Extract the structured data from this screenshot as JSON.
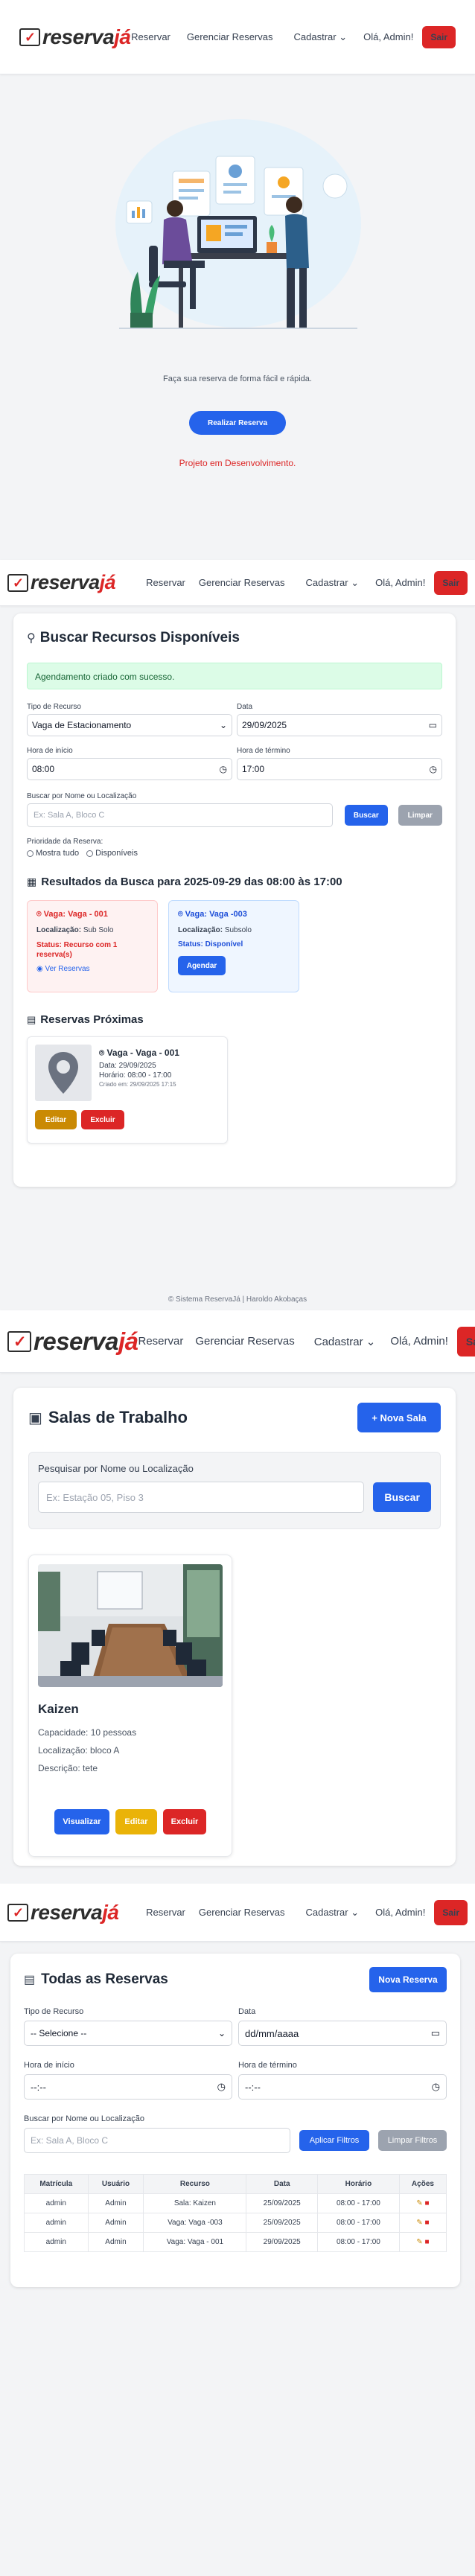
{
  "brand": {
    "part1": "reserva",
    "part2": "já"
  },
  "nav": {
    "reservar": "Reservar",
    "gerenciar": "Gerenciar Reservas",
    "cadastrar": "Cadastrar",
    "greeting": "Olá, Admin!",
    "logout": "Sair"
  },
  "home": {
    "tagline": "Faça sua reserva de forma fácil e rápida.",
    "cta": "Realizar Reserva",
    "dev_notice": "Projeto em Desenvolvimento."
  },
  "search": {
    "title": "Buscar Recursos Disponíveis",
    "success": "Agendamento criado com sucesso.",
    "tipo_label": "Tipo de Recurso",
    "tipo_value": "Vaga de Estacionamento",
    "data_label": "Data",
    "data_value": "29/09/2025",
    "inicio_label": "Hora de início",
    "inicio_value": "08:00",
    "termino_label": "Hora de término",
    "termino_value": "17:00",
    "busca_label": "Buscar por Nome ou Localização",
    "busca_placeholder": "Ex: Sala A, Bloco C",
    "buscar_btn": "Buscar",
    "limpar_btn": "Limpar",
    "prioridade_label": "Prioridade da Reserva:",
    "opt_all": "Mostra tudo",
    "opt_avail": "Disponíveis",
    "results_title": "Resultados da Busca para 2025-09-29 das 08:00 às 17:00",
    "results": [
      {
        "name": "Vaga: Vaga - 001",
        "loc_label": "Localização:",
        "loc": "Sub Solo",
        "status": "Status: Recurso com 1 reserva(s)",
        "action": "Ver Reservas"
      },
      {
        "name": "Vaga: Vaga -003",
        "loc_label": "Localização:",
        "loc": "Subsolo",
        "status": "Status: Disponível",
        "action": "Agendar"
      }
    ],
    "upcoming_title": "Reservas Próximas",
    "upcoming": {
      "name": "Vaga - Vaga - 001",
      "date": "Data: 29/09/2025",
      "time": "Horário: 08:00 - 17:00",
      "created": "Criado em: 29/09/2025 17:15",
      "edit": "Editar",
      "delete": "Excluir"
    },
    "footer": "© Sistema ReservaJá | Haroldo Akobaças"
  },
  "rooms": {
    "title": "Salas de Trabalho",
    "new_btn": "+ Nova Sala",
    "search_label": "Pesquisar por Nome ou Localização",
    "search_placeholder": "Ex: Estação 05, Piso 3",
    "search_btn": "Buscar",
    "room": {
      "name": "Kaizen",
      "capacity": "Capacidade: 10 pessoas",
      "location": "Localização: bloco A",
      "description": "Descrição: tete",
      "view": "Visualizar",
      "edit": "Editar",
      "delete": "Excluir"
    }
  },
  "reservations": {
    "title": "Todas as Reservas",
    "new_btn": "Nova Reserva",
    "tipo_label": "Tipo de Recurso",
    "tipo_value": "-- Selecione --",
    "data_label": "Data",
    "data_value": "dd/mm/aaaa",
    "inicio_label": "Hora de início",
    "inicio_value": "--:--",
    "termino_label": "Hora de término",
    "termino_value": "--:--",
    "busca_label": "Buscar por Nome ou Localização",
    "busca_placeholder": "Ex: Sala A, Bloco C",
    "apply_btn": "Aplicar Filtros",
    "clear_btn": "Limpar Filtros",
    "headers": [
      "Matrícula",
      "Usuário",
      "Recurso",
      "Data",
      "Horário",
      "Ações"
    ],
    "rows": [
      [
        "admin",
        "Admin",
        "Sala: Kaizen",
        "25/09/2025",
        "08:00 - 17:00"
      ],
      [
        "admin",
        "Admin",
        "Vaga: Vaga -003",
        "25/09/2025",
        "08:00 - 17:00"
      ],
      [
        "admin",
        "Admin",
        "Vaga: Vaga - 001",
        "29/09/2025",
        "08:00 - 17:00"
      ]
    ]
  },
  "colors": {
    "primary": "#2563eb",
    "danger": "#dc2626",
    "warning": "#ca8a04",
    "success_bg": "#dcfce7"
  }
}
